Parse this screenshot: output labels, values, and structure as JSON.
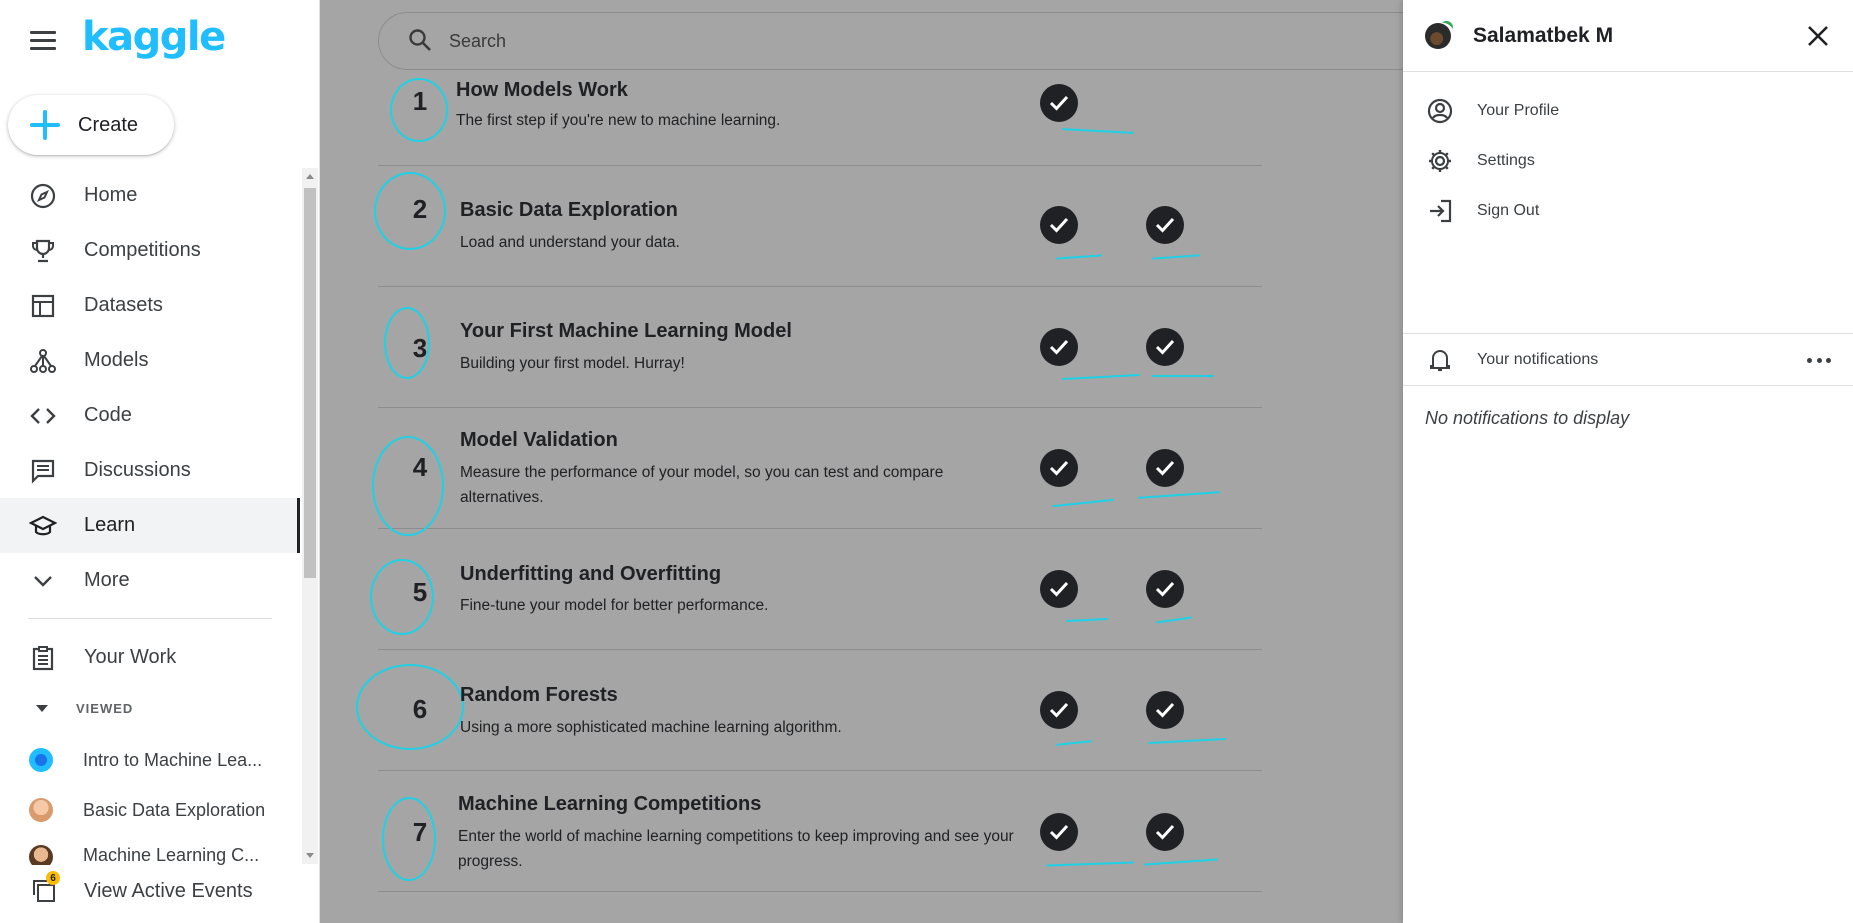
{
  "app": {
    "logo": "kaggle"
  },
  "sidebar": {
    "create_label": "Create",
    "items": [
      {
        "label": "Home",
        "icon": "compass-icon"
      },
      {
        "label": "Competitions",
        "icon": "trophy-icon"
      },
      {
        "label": "Datasets",
        "icon": "table-icon"
      },
      {
        "label": "Models",
        "icon": "models-icon"
      },
      {
        "label": "Code",
        "icon": "code-icon"
      },
      {
        "label": "Discussions",
        "icon": "discussion-icon"
      },
      {
        "label": "Learn",
        "icon": "graduation-cap-icon",
        "active": true
      },
      {
        "label": "More",
        "icon": "chevron-down-icon"
      }
    ],
    "your_work": "Your Work",
    "viewed_header": "VIEWED",
    "viewed": [
      {
        "label": "Intro to Machine Lea..."
      },
      {
        "label": "Basic Data Exploration"
      },
      {
        "label": "Machine Learning C..."
      }
    ],
    "events_label": "View Active Events",
    "events_badge": "6"
  },
  "search": {
    "placeholder": "Search"
  },
  "lessons": [
    {
      "num": "1",
      "title": "How Models Work",
      "desc": "The first step if you're new to machine learning."
    },
    {
      "num": "2",
      "title": "Basic Data Exploration",
      "desc": "Load and understand your data."
    },
    {
      "num": "3",
      "title": "Your First Machine Learning Model",
      "desc": "Building your first model. Hurray!"
    },
    {
      "num": "4",
      "title": "Model Validation",
      "desc": "Measure the performance of your model, so you can test and compare alternatives."
    },
    {
      "num": "5",
      "title": "Underfitting and Overfitting",
      "desc": "Fine-tune your model for better performance."
    },
    {
      "num": "6",
      "title": "Random Forests",
      "desc": "Using a more sophisticated machine learning algorithm."
    },
    {
      "num": "7",
      "title": "Machine Learning Competitions",
      "desc": "Enter the world of machine learning competitions to keep improving and see your progress."
    }
  ],
  "account": {
    "name": "Salamatbek M",
    "menu": [
      {
        "label": "Your Profile",
        "icon": "profile-icon"
      },
      {
        "label": "Settings",
        "icon": "gear-icon"
      },
      {
        "label": "Sign Out",
        "icon": "sign-out-icon"
      }
    ],
    "notifications_label": "Your notifications",
    "empty_text": "No notifications to display"
  },
  "colors": {
    "brand": "#20beff",
    "annotation": "#1fd1e6",
    "overlay": "#a5a5a5"
  }
}
